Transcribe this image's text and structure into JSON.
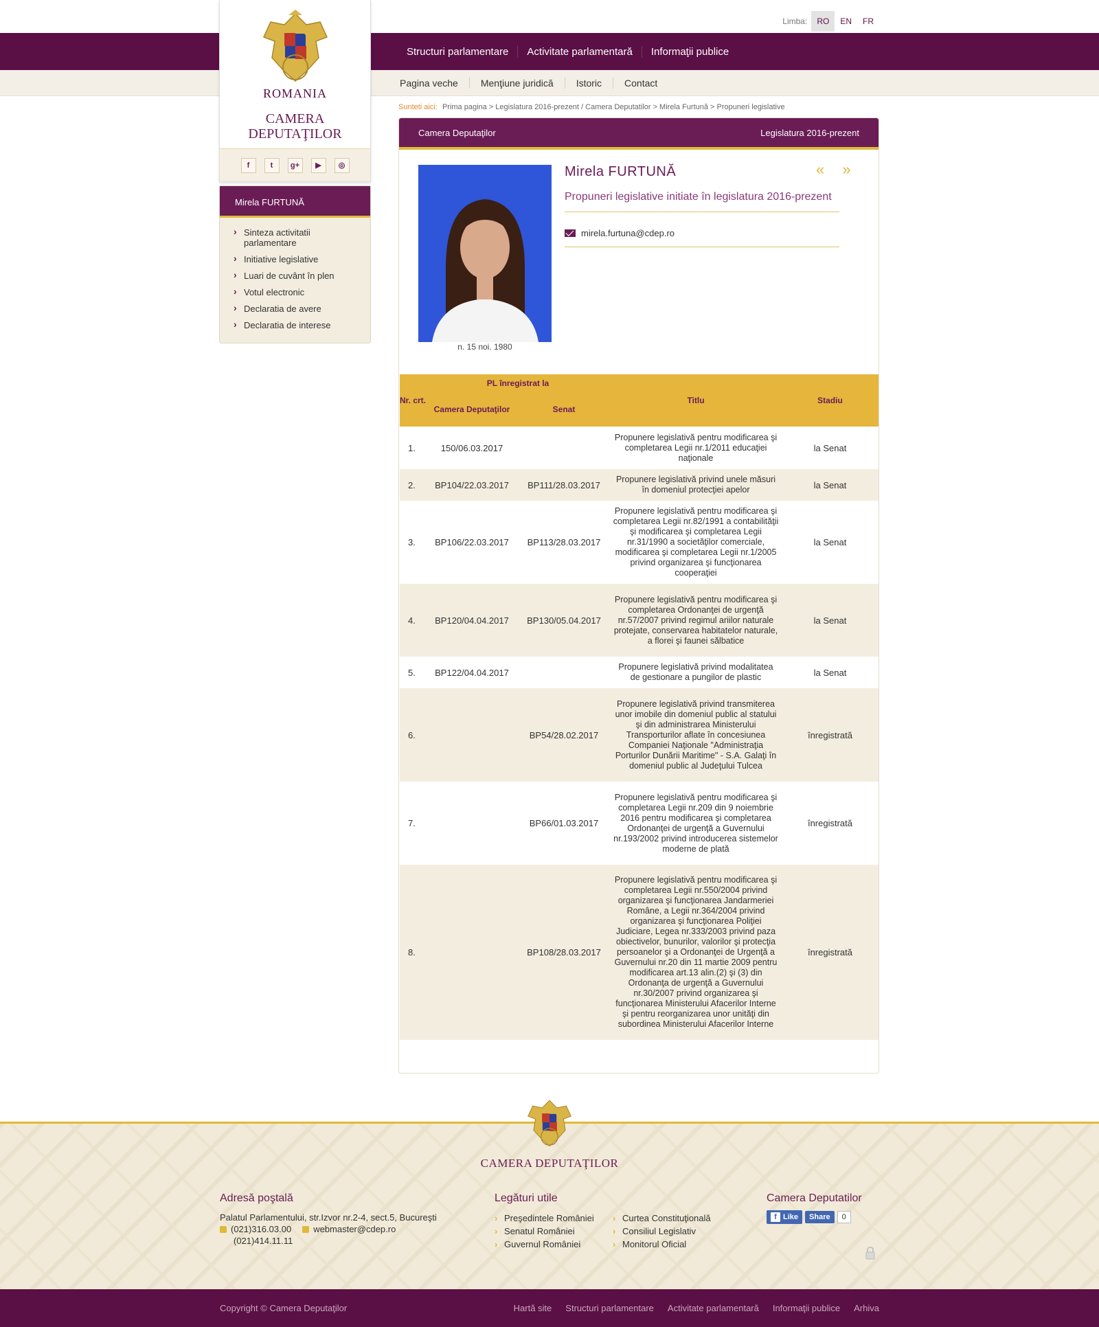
{
  "lang": {
    "label": "Limba:",
    "options": [
      "RO",
      "EN",
      "FR"
    ]
  },
  "main_nav": [
    "Structuri parlamentare",
    "Activitate parlamentară",
    "Informaţii publice"
  ],
  "sub_nav": [
    "Pagina veche",
    "Menţiune juridică",
    "Istoric",
    "Contact"
  ],
  "logo": {
    "country": "ROMANIA",
    "chamber_line1": "CAMERA",
    "chamber_line2": "DEPUTAŢILOR"
  },
  "social_icons": [
    "facebook-icon",
    "twitter-icon",
    "googleplus-icon",
    "youtube-icon",
    "instagram-icon"
  ],
  "social_glyphs": [
    "f",
    "t",
    "g+",
    "▶",
    "◎"
  ],
  "side_menu": {
    "title": "Mirela FURTUNĂ",
    "items": [
      "Sinteza activitatii parlamentare",
      "Initiative legislative",
      "Luari de cuvânt în plen",
      "Votul electronic",
      "Declaratia de avere",
      "Declaratia de interese"
    ]
  },
  "breadcrumb": {
    "label": "Sunteti aici:",
    "path": "Prima pagina > Legislatura 2016-prezent / Camera Deputatilor > Mirela Furtună > Propuneri legislative"
  },
  "content_head": {
    "left": "Camera Deputaţilor",
    "right": "Legislatura 2016-prezent"
  },
  "profile": {
    "name": "Mirela FURTUNĂ",
    "arrows": "« »",
    "subtitle": "Propuneri legislative initiate în legislatura 2016-prezent",
    "email": "mirela.furtuna@cdep.ro",
    "birth": "n. 15 noi. 1980"
  },
  "table": {
    "headers": {
      "nr": "Nr. crt.",
      "pl": "PL înregistrat la",
      "cd": "Camera Deputaţilor",
      "senat": "Senat",
      "titlu": "Titlu",
      "stadiu": "Stadiu"
    },
    "rows": [
      {
        "nr": "1.",
        "cd": "150/06.03.2017",
        "senat": "",
        "titlu": "Propunere legislativă pentru modificarea şi completarea Legii nr.1/2011 educaţiei naţionale",
        "stadiu": "la Senat"
      },
      {
        "nr": "2.",
        "cd": "BP104/22.03.2017",
        "senat": "BP111/28.03.2017",
        "titlu": "Propunere legislativă privind unele măsuri în domeniul protecţiei apelor",
        "stadiu": "la Senat"
      },
      {
        "nr": "3.",
        "cd": "BP106/22.03.2017",
        "senat": "BP113/28.03.2017",
        "titlu": "Propunere legislativă pentru modificarea şi completarea Legii nr.82/1991 a contabilităţii şi modificarea şi completarea Legii nr.31/1990 a societăţilor comerciale, modificarea şi completarea Legii nr.1/2005 privind organizarea şi funcţionarea cooperaţiei",
        "stadiu": "la Senat"
      },
      {
        "nr": "4.",
        "cd": "BP120/04.04.2017",
        "senat": "BP130/05.04.2017",
        "titlu": "Propunere legislativă pentru modificarea şi completarea Ordonanţei de urgenţă nr.57/2007 privind regimul ariilor naturale protejate, conservarea habitatelor naturale, a florei şi faunei sălbatice",
        "stadiu": "la Senat"
      },
      {
        "nr": "5.",
        "cd": "BP122/04.04.2017",
        "senat": "",
        "titlu": "Propunere legislativă privind modalitatea de gestionare a pungilor de plastic",
        "stadiu": "la Senat"
      },
      {
        "nr": "6.",
        "cd": "",
        "senat": "BP54/28.02.2017",
        "titlu": "Propunere legislativă privind transmiterea unor imobile din domeniul public al statului şi din administrarea Ministerului Transporturilor aflate în concesiunea Companiei Naţionale \"Administraţia Porturilor Dunării Maritime\" - S.A. Galaţi în domeniul public al Judeţului Tulcea",
        "stadiu": "înregistrată"
      },
      {
        "nr": "7.",
        "cd": "",
        "senat": "BP66/01.03.2017",
        "titlu": "Propunere legislativă pentru modificarea şi completarea Legii nr.209 din 9 noiembrie 2016 pentru modificarea şi completarea Ordonanţei de urgenţă a Guvernului nr.193/2002 privind introducerea sistemelor moderne de plată",
        "stadiu": "înregistrată"
      },
      {
        "nr": "8.",
        "cd": "",
        "senat": "BP108/28.03.2017",
        "titlu": "Propunere legislativă pentru modificarea şi completarea Legii nr.550/2004 privind organizarea şi funcţionarea Jandarmeriei Române, a Legii nr.364/2004 privind organizarea şi funcţionarea Poliţiei Judiciare, Legea nr.333/2003 privind paza obiectivelor, bunurilor, valorilor şi protecţia persoanelor şi a Ordonanţei de Urgenţă a Guvernului nr.20 din 11 martie 2009 pentru modificarea art.13 alin.(2) şi (3) din Ordonanţa de urgenţă a Guvernului nr.30/2007 privind organizarea şi funcţionarea Ministerului Afacerilor Interne şi pentru reorganizarea unor unităţi din subordinea Ministerului Afacerilor Interne",
        "stadiu": "înregistrată"
      }
    ]
  },
  "footer": {
    "camera": "CAMERA DEPUTAŢILOR",
    "address_title": "Adresă poştală",
    "address": "Palatul Parlamentului, str.Izvor nr.2-4, sect.5, Bucureşti",
    "phone1": "(021)316.03.00",
    "email": "webmaster@cdep.ro",
    "phone2": "(021)414.11.11",
    "links_title": "Legături utile",
    "links_col1": [
      "Preşedintele României",
      "Senatul României",
      "Guvernul României"
    ],
    "links_col2": [
      "Curtea Constituţională",
      "Consiliul Legislativ",
      "Monitorul Oficial"
    ],
    "social_title": "Camera Deputatilor",
    "fb_like": "Like",
    "fb_share": "Share",
    "fb_count": "0"
  },
  "bottom": {
    "copyright": "Copyright © Camera Deputaţilor",
    "links": [
      "Hartă site",
      "Structuri parlamentare",
      "Activitate parlamentară",
      "Informaţii publice",
      "Arhiva"
    ]
  },
  "colors": {
    "brand": "#5a0f45",
    "accent": "#e0b93a",
    "beige": "#f3ede0"
  }
}
